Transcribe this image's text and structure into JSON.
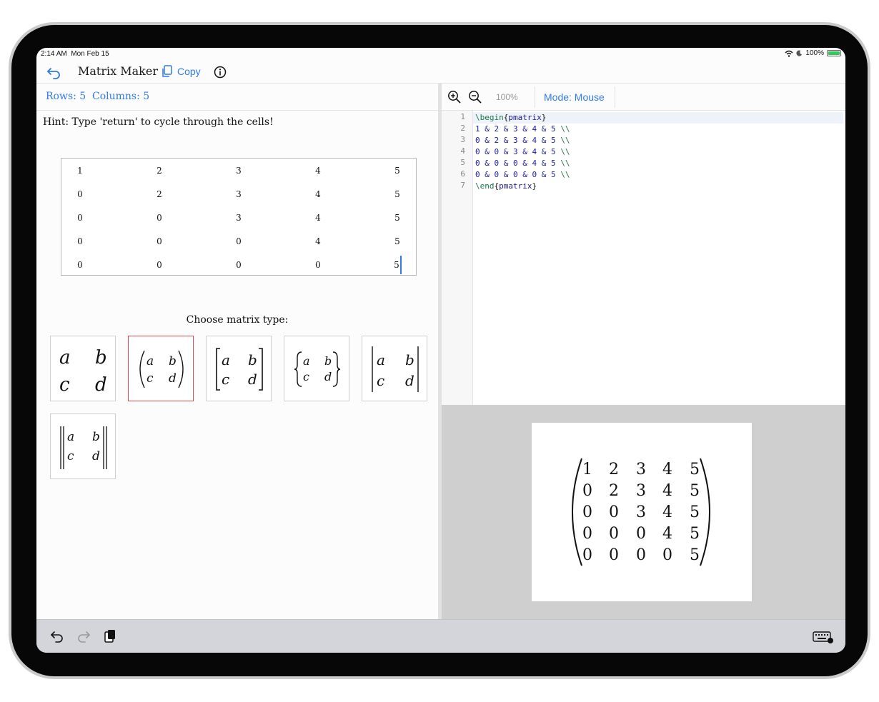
{
  "status": {
    "time": "2:14 AM",
    "date": "Mon Feb 15",
    "battery": "100%"
  },
  "nav": {
    "title": "Matrix Maker",
    "copy_label": "Copy"
  },
  "dims": {
    "rows": "Rows: 5",
    "columns": "Columns: 5"
  },
  "hint": "Hint: Type 'return' to cycle through the cells!",
  "matrix": [
    [
      "1",
      "2",
      "3",
      "4",
      "5"
    ],
    [
      "0",
      "2",
      "3",
      "4",
      "5"
    ],
    [
      "0",
      "0",
      "3",
      "4",
      "5"
    ],
    [
      "0",
      "0",
      "0",
      "4",
      "5"
    ],
    [
      "0",
      "0",
      "0",
      "0",
      "5"
    ]
  ],
  "choose_label": "Choose matrix type:",
  "matrix_types": [
    {
      "name": "matrix",
      "selected": false
    },
    {
      "name": "pmatrix",
      "selected": true
    },
    {
      "name": "bmatrix",
      "selected": false
    },
    {
      "name": "Bmatrix",
      "selected": false
    },
    {
      "name": "vmatrix",
      "selected": false
    },
    {
      "name": "Vmatrix",
      "selected": false
    }
  ],
  "type_letters": [
    "a",
    "b",
    "c",
    "d"
  ],
  "toolbar": {
    "zoom": "100%",
    "mode": "Mode: Mouse"
  },
  "code": {
    "line_numbers": [
      "1",
      "2",
      "3",
      "4",
      "5",
      "6",
      "7"
    ],
    "begin_cmd": "\\begin",
    "begin_arg": "pmatrix",
    "rows": [
      "1 & 2 & 3 & 4 & 5",
      "0 & 2 & 3 & 4 & 5",
      "0 & 0 & 3 & 4 & 5",
      "0 & 0 & 0 & 4 & 5",
      "0 & 0 & 0 & 0 & 5"
    ],
    "row_end": "\\\\",
    "end_cmd": "\\end",
    "end_arg": "pmatrix"
  },
  "colors": {
    "accent": "#2f7bea",
    "selected_border": "#e24a4a",
    "code_keyword": "#167a45"
  }
}
